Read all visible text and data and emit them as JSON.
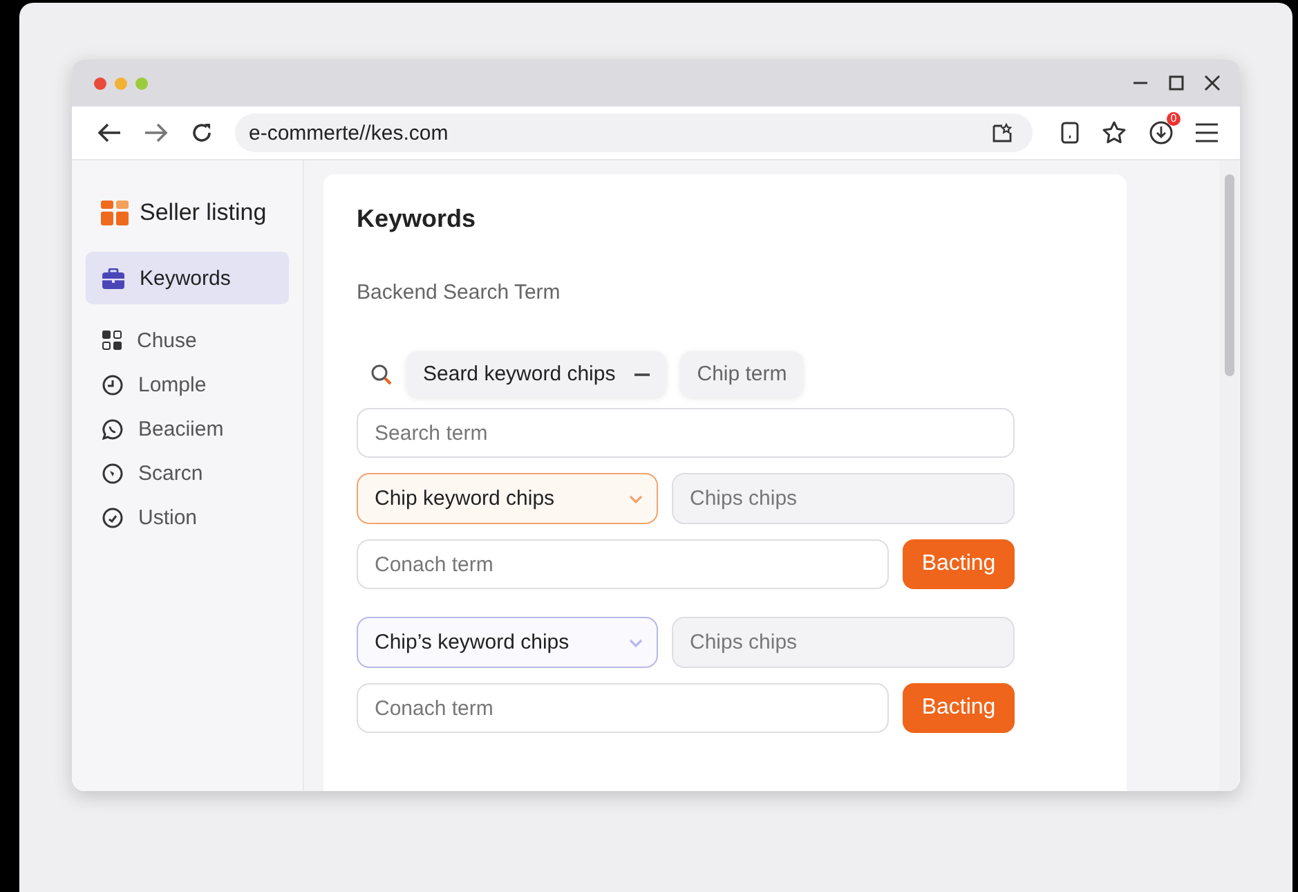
{
  "browser": {
    "url": "e-commerte//kes.com",
    "badge": "0"
  },
  "sidebar": {
    "title": "Seller listing",
    "items": [
      {
        "label": "Keywords",
        "selected": true
      },
      {
        "label": "Chuse",
        "selected": false
      },
      {
        "label": "Lomple",
        "selected": false
      },
      {
        "label": "Beaciiem",
        "selected": false
      },
      {
        "label": "Scarcn",
        "selected": false
      },
      {
        "label": "Ustion",
        "selected": false
      }
    ]
  },
  "main": {
    "title": "Keywords",
    "subtitle": "Backend Search Term",
    "chips": [
      {
        "label": "Seard keyword chips",
        "removable": true
      },
      {
        "label": "Chip term",
        "removable": false
      }
    ],
    "search": {
      "placeholder": "Search term"
    },
    "groups": [
      {
        "select": "Chip keyword chips",
        "color": "#f3a46c",
        "chips_field": {
          "placeholder": "Chips chips"
        },
        "term": {
          "placeholder": "Conach term"
        },
        "button": "Bacting"
      },
      {
        "select": "Chip’s keyword chips",
        "color": "#b8b8ec",
        "chips_field": {
          "placeholder": "Chips chips"
        },
        "term": {
          "placeholder": "Conach term"
        },
        "button": "Bacting"
      }
    ]
  }
}
